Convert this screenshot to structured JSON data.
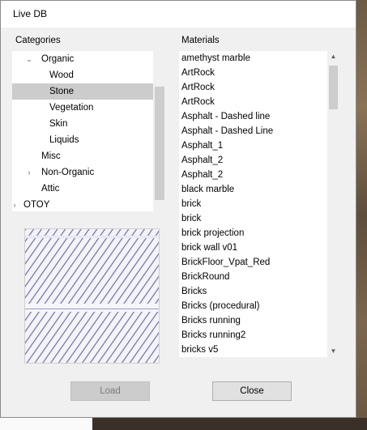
{
  "window": {
    "title": "Live DB"
  },
  "categories": {
    "label": "Categories",
    "items": [
      {
        "label": "Organic",
        "arrow": "⌄",
        "level": 1,
        "selected": false
      },
      {
        "label": "Wood",
        "arrow": "",
        "level": 2,
        "selected": false
      },
      {
        "label": "Stone",
        "arrow": "",
        "level": 2,
        "selected": true
      },
      {
        "label": "Vegetation",
        "arrow": "",
        "level": 2,
        "selected": false
      },
      {
        "label": "Skin",
        "arrow": "",
        "level": 2,
        "selected": false
      },
      {
        "label": "Liquids",
        "arrow": "",
        "level": 2,
        "selected": false
      },
      {
        "label": "Misc",
        "arrow": "",
        "level": 1,
        "selected": false
      },
      {
        "label": "Non-Organic",
        "arrow": "›",
        "level": 1,
        "selected": false
      },
      {
        "label": "Attic",
        "arrow": "",
        "level": 1,
        "selected": false
      },
      {
        "label": "OTOY",
        "arrow": "›",
        "level": 0,
        "selected": false
      }
    ]
  },
  "materials": {
    "label": "Materials",
    "items": [
      "amethyst marble",
      "ArtRock",
      "ArtRock",
      "ArtRock",
      "Asphalt - Dashed line",
      "Asphalt - Dashed Line",
      "Asphalt_1",
      "Asphalt_2",
      "Asphalt_2",
      "black marble",
      "brick",
      "brick",
      "brick projection",
      "brick wall v01",
      "BrickFloor_Vpat_Red",
      "BrickRound",
      "Bricks",
      "Bricks (procedural)",
      "Bricks running",
      "Bricks running2",
      "bricks v5"
    ]
  },
  "buttons": {
    "load": "Load",
    "close": "Close"
  },
  "colors": {
    "selection": "#cccccc",
    "list_bg": "#ffffff",
    "dialog_bg": "#f0f0f0"
  }
}
